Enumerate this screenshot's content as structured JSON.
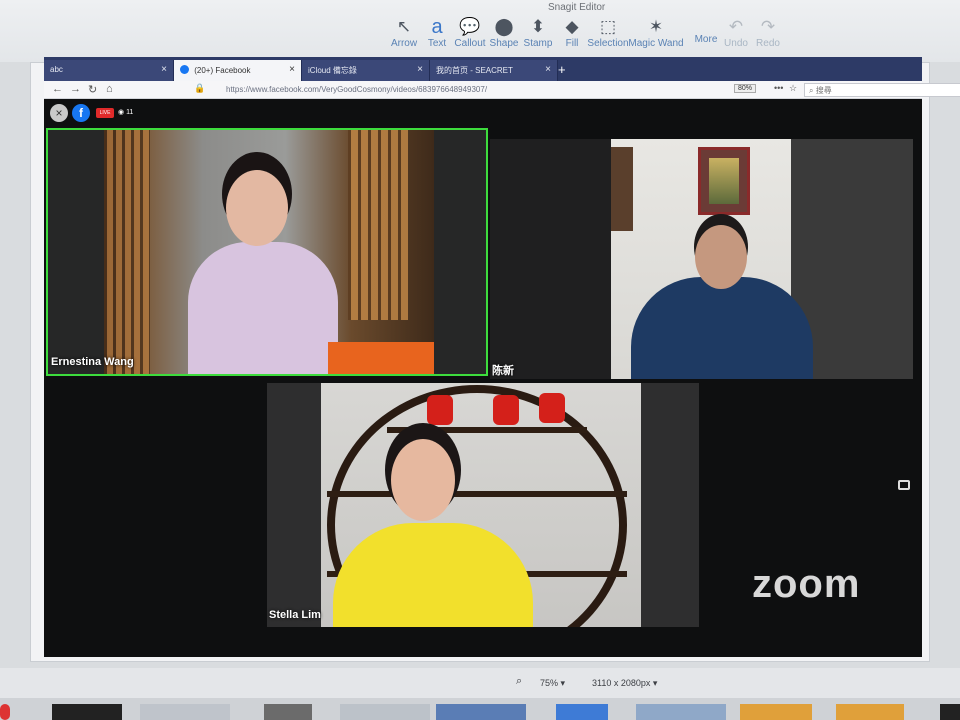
{
  "snagit": {
    "title": "Snagit Editor",
    "tools": [
      {
        "label": "Arrow",
        "icon": "↖",
        "name": "arrow-tool"
      },
      {
        "label": "Text",
        "icon": "a",
        "name": "text-tool"
      },
      {
        "label": "Callout",
        "icon": "💬",
        "name": "callout-tool"
      },
      {
        "label": "Shape",
        "icon": "⬤",
        "name": "shape-tool"
      },
      {
        "label": "Stamp",
        "icon": "⬍",
        "name": "stamp-tool"
      },
      {
        "label": "Fill",
        "icon": "◆",
        "name": "fill-tool"
      },
      {
        "label": "Selection",
        "icon": "⬚",
        "name": "selection-tool"
      },
      {
        "label": "Magic Wand",
        "icon": "✶",
        "name": "magic-wand-tool"
      },
      {
        "label": "More",
        "icon": "",
        "name": "more-tools"
      },
      {
        "label": "Undo",
        "icon": "↶",
        "name": "undo-button"
      },
      {
        "label": "Redo",
        "icon": "↷",
        "name": "redo-button"
      }
    ],
    "zoom": "75%",
    "dimensions": "3110 x 2080px"
  },
  "browser": {
    "tabs": [
      {
        "label": "abc"
      },
      {
        "label": "(20+) Facebook"
      },
      {
        "label": "iCloud 備忘錄"
      },
      {
        "label": "我的首页 - SEACRET"
      }
    ],
    "url": "https://www.facebook.com/VeryGoodCosmony/videos/683976648949307/",
    "zoom": "80%",
    "search_placeholder": "搜尋"
  },
  "stream": {
    "views": "11",
    "live": "LIVE",
    "participants": [
      {
        "name": "Ernestina Wang"
      },
      {
        "name": "陈新"
      },
      {
        "name": "Stella Lim"
      }
    ],
    "logo": "zoom"
  }
}
